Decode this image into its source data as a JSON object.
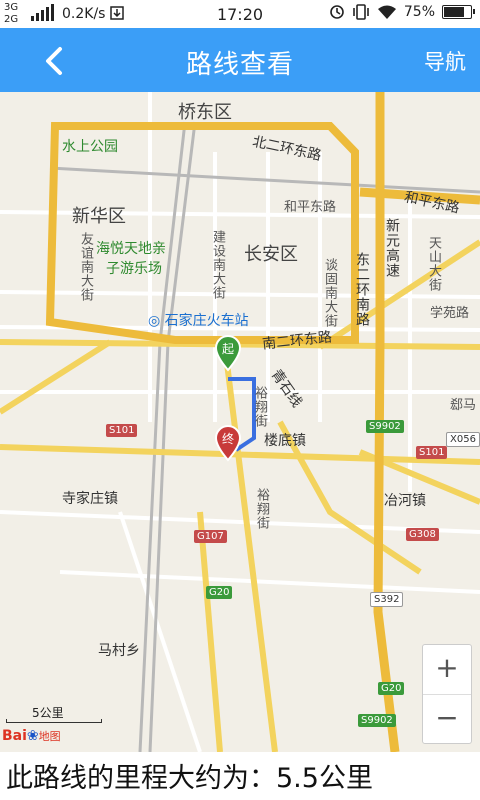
{
  "status_bar": {
    "network_top": "3G",
    "network_bottom": "2G",
    "speed": "0.2K/s",
    "time": "17:20",
    "battery": "75%",
    "battery_level": 0.75,
    "icons": [
      "signal-icon",
      "download-icon",
      "alarm-icon",
      "vibrate-icon",
      "wifi-icon",
      "battery-icon"
    ]
  },
  "header": {
    "title": "路线查看",
    "back_icon": "chevron-left-icon",
    "nav_label": "导航"
  },
  "map": {
    "districts": {
      "qiaodong": "桥东区",
      "xinhua": "新华区",
      "changan": "长安区"
    },
    "places": {
      "park": "水上公园",
      "amusement_1": "海悦天地亲",
      "amusement_2": "子游乐场",
      "station": "石家庄火车站",
      "lou_di": "楼底镇",
      "si_jia_zhuang": "寺家庄镇",
      "ye_he": "冶河镇",
      "ma_cun": "马村乡",
      "xue_yuan": "学苑路",
      "jun_ma": "郄马"
    },
    "roads": {
      "north_ring": "北二环东路",
      "south_ring": "南二环东路",
      "east_ring": "东二环南路",
      "heping_1": "和平东路",
      "heping_2": "和平东路",
      "xinyuan": "新元高速",
      "youyi": "友谊南大街",
      "jianshe": "建设南大街",
      "tangu": "谈固南大街",
      "tianshan": "天山大街",
      "qingshi": "青石线",
      "yuxiang_1": "裕翔街",
      "yuxiang_2": "裕翔街"
    },
    "shields": {
      "s101_left": "S101",
      "s101_right": "S101",
      "s9902_top": "S9902",
      "s9902_bottom": "S9902",
      "x056": "X056",
      "g107": "G107",
      "g308": "G308",
      "g20_top": "G20",
      "g20_bottom": "G20",
      "s392": "S392"
    },
    "start_marker": "起",
    "end_marker": "终",
    "scale": "5公里",
    "logo_bai": "Bai",
    "logo_du": "du",
    "logo_map": "地图",
    "zoom_in": "+",
    "zoom_out": "−"
  },
  "footer": {
    "distance_text": "此路线的里程大约为：5.5公里"
  }
}
